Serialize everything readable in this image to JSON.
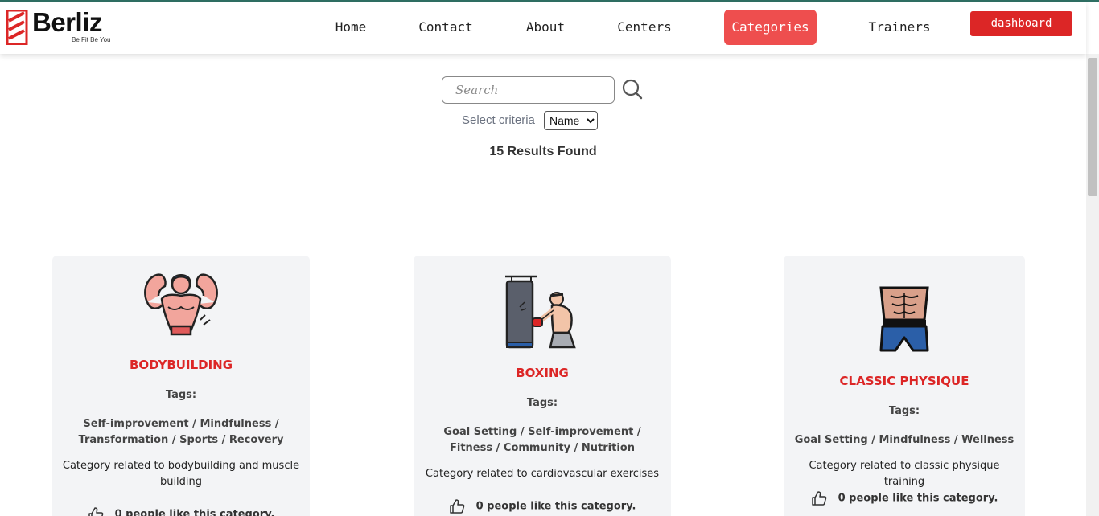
{
  "brand": {
    "name": "Berliz",
    "tagline": "Be Fit Be You",
    "color": "#dc2626"
  },
  "nav": {
    "items": [
      "Home",
      "Contact",
      "About",
      "Centers",
      "Categories",
      "Trainers"
    ],
    "active": "Categories",
    "dashboard_label": "dashboard"
  },
  "search": {
    "placeholder": "Search",
    "value": "",
    "icon": "search-icon"
  },
  "criteria": {
    "label": "Select criteria",
    "selected": "Name"
  },
  "results_text": "15 Results Found",
  "cards": [
    {
      "icon": "bodybuilder-icon",
      "title": "BODYBUILDING",
      "tags_label": "Tags:",
      "tags": "Self-improvement / Mindfulness / Transformation / Sports / Recovery",
      "description": "Category related to bodybuilding and muscle building",
      "likes": "0 people like this category."
    },
    {
      "icon": "boxing-icon",
      "title": "BOXING",
      "tags_label": "Tags:",
      "tags": "Goal Setting / Self-improvement / Fitness / Community / Nutrition",
      "description": "Category related to cardiovascular exercises",
      "likes": "0 people like this category."
    },
    {
      "icon": "abs-torso-icon",
      "title": "CLASSIC PHYSIQUE",
      "tags_label": "Tags:",
      "tags": "Goal Setting / Mindfulness / Wellness",
      "description": "Category related to classic physique training",
      "likes": "0 people like this category."
    }
  ]
}
